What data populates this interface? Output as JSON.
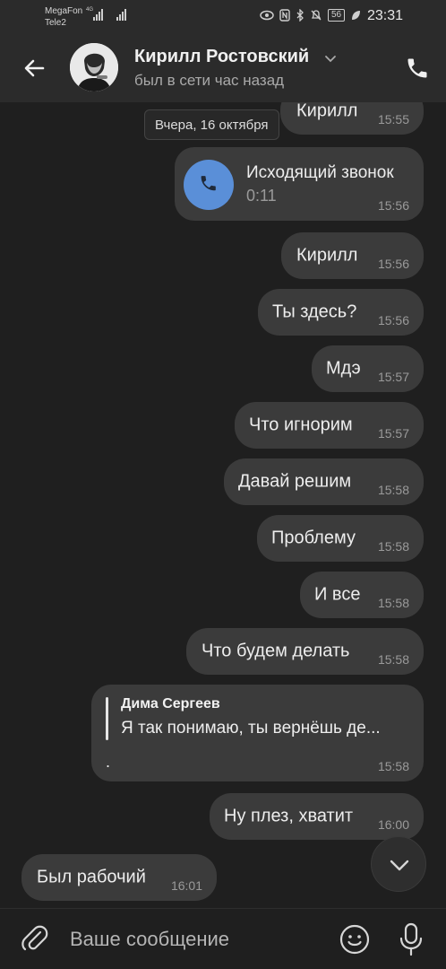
{
  "status_bar": {
    "carrier1": "MegaFon",
    "carrier2": "Tele2",
    "network": "4G",
    "battery": "56",
    "time": "23:31"
  },
  "header": {
    "name": "Кирилл Ростовский",
    "status": "был в сети час назад",
    "icons": {
      "back": "arrow-left-icon",
      "call": "phone-icon",
      "dropdown": "chevron-down-icon"
    }
  },
  "date_chip": "Вчера, 16 октября",
  "messages": [
    {
      "text": "Кирилл",
      "time": "15:55"
    },
    {
      "type": "call",
      "title": "Исходящий звонок",
      "duration": "0:11",
      "time": "15:56"
    },
    {
      "text": "Кирилл",
      "time": "15:56"
    },
    {
      "text": "Ты здесь?",
      "time": "15:56"
    },
    {
      "text": "Мдэ",
      "time": "15:57"
    },
    {
      "text": "Что игнорим",
      "time": "15:57"
    },
    {
      "text": "Давай решим",
      "time": "15:58"
    },
    {
      "text": "Проблему",
      "time": "15:58"
    },
    {
      "text": "И все",
      "time": "15:58"
    },
    {
      "text": "Что будем делать",
      "time": "15:58"
    },
    {
      "type": "reply",
      "author": "Дима Сергеев",
      "quote": "Я так понимаю, ты вернёшь де...",
      "text": ".",
      "time": "15:58"
    },
    {
      "text": "Ну плез, хватит",
      "time": "16:00"
    },
    {
      "text": "Был рабочий",
      "time": "16:01",
      "incoming": true
    }
  ],
  "composer": {
    "placeholder": "Ваше сообщение",
    "icons": {
      "attach": "paperclip-icon",
      "emoji": "emoji-icon",
      "mic": "microphone-icon"
    }
  },
  "colors": {
    "background": "#1f1f1f",
    "bar": "#2b2b2b",
    "bubble": "#3b3b3b",
    "call_accent": "#5a8fd8"
  }
}
